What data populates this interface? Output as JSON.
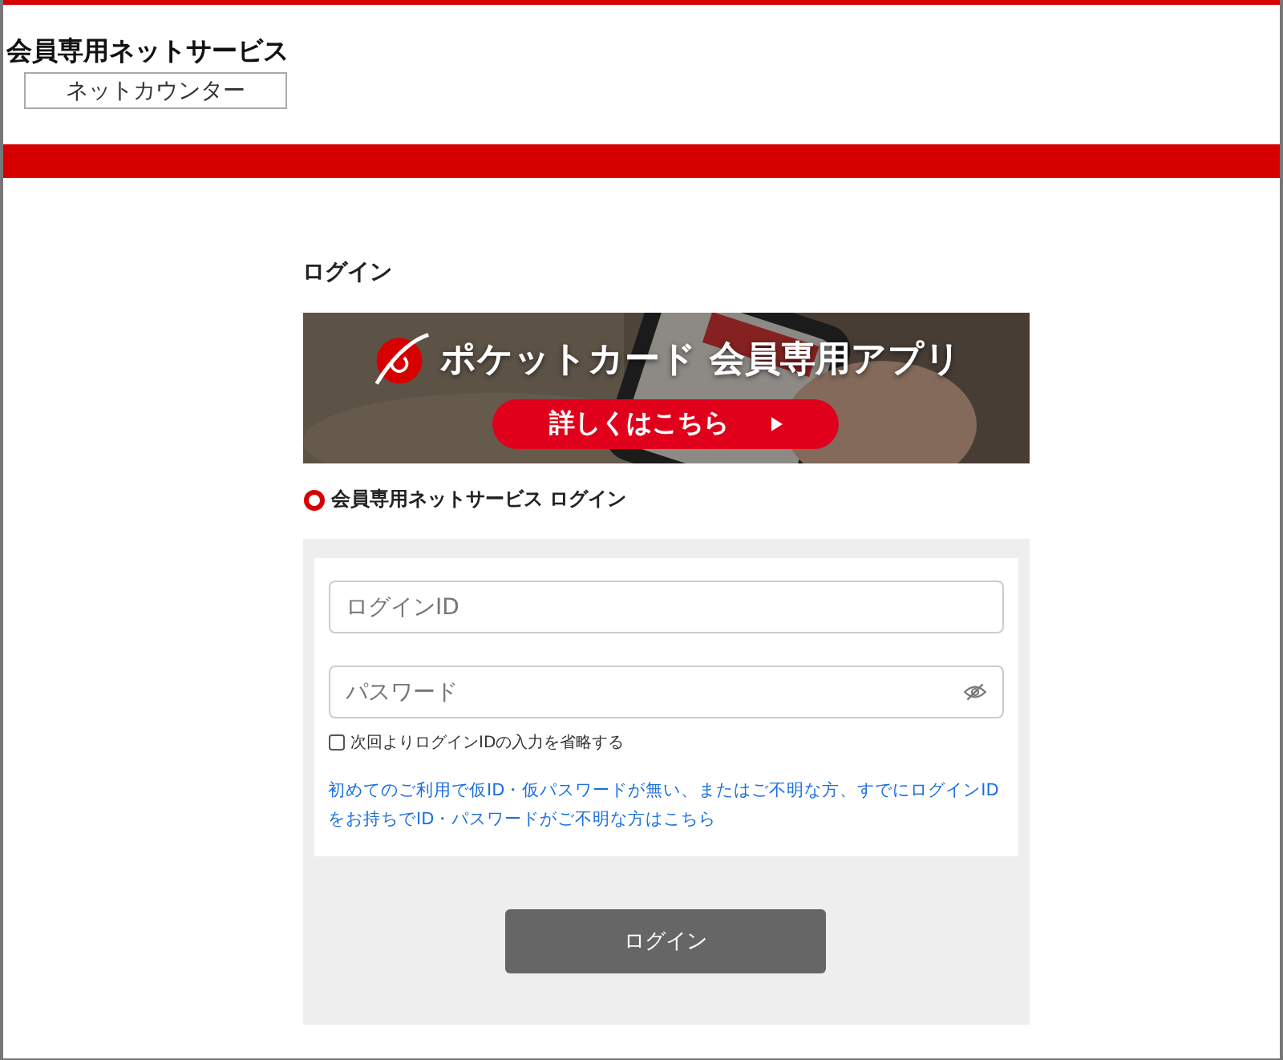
{
  "header": {
    "title": "会員専用ネットサービス",
    "counter_button": "ネットカウンター"
  },
  "login_heading": "ログイン",
  "banner": {
    "kind": "picture",
    "headline": "ポケットカード 会員専用アプリ",
    "button": "詳しくはこちら"
  },
  "section_title": "会員専用ネットサービス ログイン",
  "form": {
    "login_id": {
      "placeholder": "ログインID"
    },
    "password": {
      "placeholder": "パスワード"
    },
    "remember": {
      "label": "次回よりログインIDの入力を省略する",
      "checked": false
    },
    "help_link": "初めてのご利用で仮ID・仮パスワードが無い、またはご不明な方、すでにログインIDをお持ちでID・パスワードがご不明な方はこちら"
  },
  "submit": "ログイン"
}
